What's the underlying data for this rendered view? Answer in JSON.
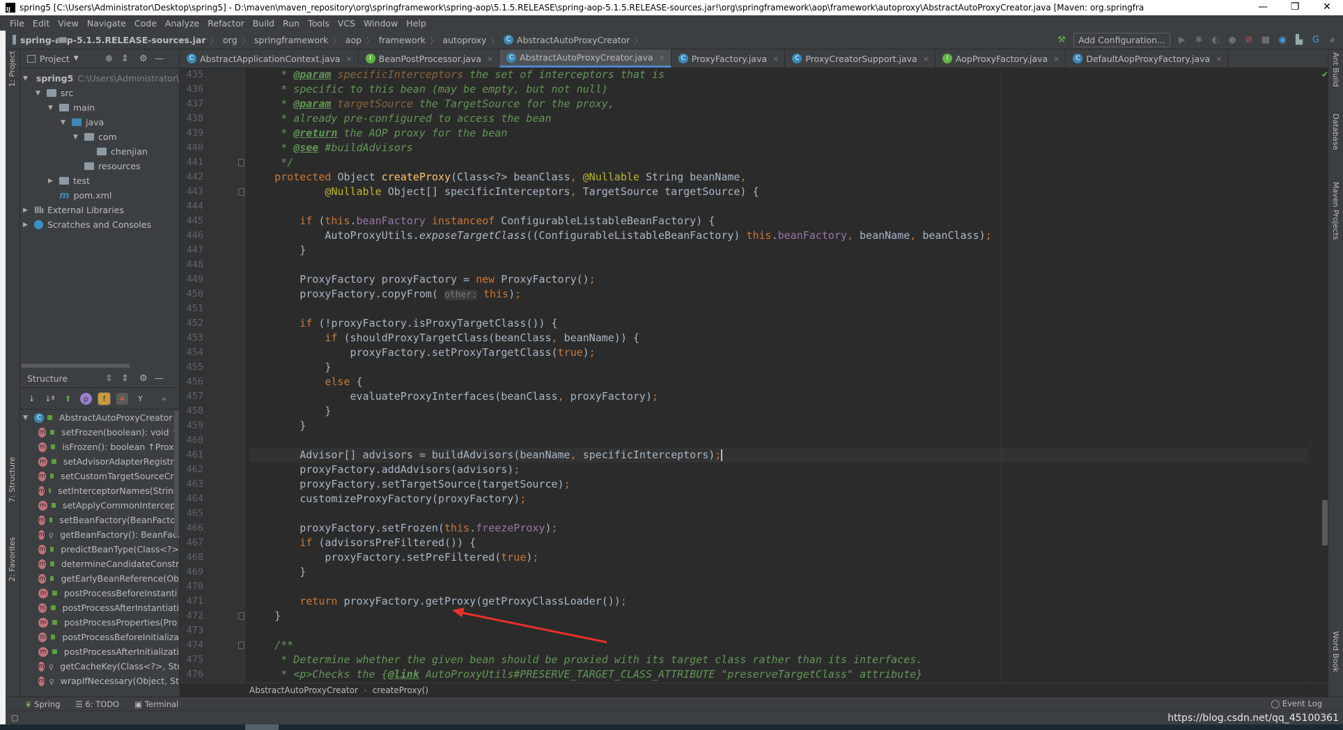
{
  "window": {
    "title": "spring5 [C:\\Users\\Administrator\\Desktop\\spring5] - D:\\maven\\maven_repository\\org\\springframework\\spring-aop\\5.1.5.RELEASE\\spring-aop-5.1.5.RELEASE-sources.jar!\\org\\springframework\\aop\\framework\\autoproxy\\AbstractAutoProxyCreator.java [Maven: org.springfra",
    "logo": "IJ",
    "minimize": "—",
    "restore": "❐",
    "close": "✕"
  },
  "menu": [
    "File",
    "Edit",
    "View",
    "Navigate",
    "Code",
    "Analyze",
    "Refactor",
    "Build",
    "Run",
    "Tools",
    "VCS",
    "Window",
    "Help"
  ],
  "navbar": {
    "crumbs": [
      "spring-aop-5.1.5.RELEASE-sources.jar",
      "org",
      "springframework",
      "aop",
      "framework",
      "autoproxy",
      "AbstractAutoProxyCreator"
    ],
    "add_configuration": "Add Configuration..."
  },
  "left_stripe": {
    "project": "1: Project",
    "structure": "7: Structure",
    "favorites": "2: Favorites"
  },
  "project": {
    "title": "Project",
    "tree": [
      {
        "label": "spring5",
        "hint": "C:\\Users\\Administrator\\",
        "depth": 0,
        "arrow": "▼",
        "icon": "module"
      },
      {
        "label": "src",
        "depth": 1,
        "arrow": "▼",
        "icon": "folder"
      },
      {
        "label": "main",
        "depth": 2,
        "arrow": "▼",
        "icon": "folder"
      },
      {
        "label": "java",
        "depth": 3,
        "arrow": "▼",
        "icon": "source-folder"
      },
      {
        "label": "com",
        "depth": 4,
        "arrow": "▼",
        "icon": "package"
      },
      {
        "label": "chenjian",
        "depth": 5,
        "arrow": "",
        "icon": "package"
      },
      {
        "label": "resources",
        "depth": 4,
        "arrow": "",
        "icon": "resources-folder"
      },
      {
        "label": "test",
        "depth": 2,
        "arrow": "▶",
        "icon": "folder"
      },
      {
        "label": "pom.xml",
        "depth": 2,
        "arrow": "",
        "icon": "maven"
      },
      {
        "label": "External Libraries",
        "depth": 0,
        "arrow": "▶",
        "icon": "libraries"
      },
      {
        "label": "Scratches and Consoles",
        "depth": 0,
        "arrow": "▶",
        "icon": "scratches"
      }
    ]
  },
  "structure": {
    "title": "Structure",
    "root": "AbstractAutoProxyCreator",
    "members": [
      {
        "label": "setFrozen(boolean): void ↑",
        "access": "public"
      },
      {
        "label": "isFrozen(): boolean ↑Proxy",
        "access": "public"
      },
      {
        "label": "setAdvisorAdapterRegistry",
        "access": "public"
      },
      {
        "label": "setCustomTargetSourceCre",
        "access": "public"
      },
      {
        "label": "setInterceptorNames(String",
        "access": "public"
      },
      {
        "label": "setApplyCommonIntercept",
        "access": "public"
      },
      {
        "label": "setBeanFactory(BeanFactor",
        "access": "public"
      },
      {
        "label": "getBeanFactory(): BeanFact",
        "access": "protected"
      },
      {
        "label": "predictBeanType(Class<?>",
        "access": "public"
      },
      {
        "label": "determineCandidateConstr",
        "access": "public"
      },
      {
        "label": "getEarlyBeanReference(Ob",
        "access": "public"
      },
      {
        "label": "postProcessBeforeInstanti",
        "access": "public"
      },
      {
        "label": "postProcessAfterInstantiati",
        "access": "public"
      },
      {
        "label": "postProcessProperties(Pro",
        "access": "public"
      },
      {
        "label": "postProcessBeforeInitializa",
        "access": "public"
      },
      {
        "label": "postProcessAfterInitializati",
        "access": "public"
      },
      {
        "label": "getCacheKey(Class<?>, Str",
        "access": "protected"
      },
      {
        "label": "wrapIfNecessary(Object, St",
        "access": "protected"
      }
    ]
  },
  "tabs": [
    {
      "label": "AbstractApplicationContext.java",
      "kind": "class",
      "active": false
    },
    {
      "label": "BeanPostProcessor.java",
      "kind": "interface",
      "active": false
    },
    {
      "label": "AbstractAutoProxyCreator.java",
      "kind": "class",
      "active": true
    },
    {
      "label": "ProxyFactory.java",
      "kind": "class",
      "active": false
    },
    {
      "label": "ProxyCreatorSupport.java",
      "kind": "class",
      "active": false
    },
    {
      "label": "AopProxyFactory.java",
      "kind": "interface",
      "active": false
    },
    {
      "label": "DefaultAopProxyFactory.java",
      "kind": "class",
      "active": false
    }
  ],
  "editor": {
    "first_line": 435,
    "current_line": 461,
    "folds": [
      441,
      443,
      472,
      474
    ],
    "lines": [
      [
        [
          "c",
          "     * "
        ],
        [
          "t",
          "@param"
        ],
        [
          "p",
          " specificInterceptors"
        ],
        [
          "c",
          " the set of interceptors that is"
        ]
      ],
      [
        [
          "c",
          "     * specific to this bean (may be empty, but not null)"
        ]
      ],
      [
        [
          "c",
          "     * "
        ],
        [
          "t",
          "@param"
        ],
        [
          "p",
          " targetSource"
        ],
        [
          "c",
          " the TargetSource for the proxy,"
        ]
      ],
      [
        [
          "c",
          "     * already pre-configured to access the bean"
        ]
      ],
      [
        [
          "c",
          "     * "
        ],
        [
          "t",
          "@return"
        ],
        [
          "c",
          " the AOP proxy for the bean"
        ]
      ],
      [
        [
          "c",
          "     * "
        ],
        [
          "t",
          "@see"
        ],
        [
          "c",
          " #buildAdvisors"
        ]
      ],
      [
        [
          "c",
          "     */"
        ]
      ],
      [
        [
          "n",
          "    "
        ],
        [
          "k",
          "protected "
        ],
        [
          "n",
          "Object "
        ],
        [
          "m",
          "createProxy"
        ],
        [
          "n",
          "(Class<?> beanClass"
        ],
        [
          "k",
          ", "
        ],
        [
          "a",
          "@Nullable "
        ],
        [
          "n",
          "String beanName"
        ],
        [
          "k",
          ","
        ]
      ],
      [
        [
          "n",
          "            "
        ],
        [
          "a",
          "@Nullable "
        ],
        [
          "n",
          "Object[] specificInterceptors"
        ],
        [
          "k",
          ", "
        ],
        [
          "n",
          "TargetSource targetSource) {"
        ]
      ],
      [],
      [
        [
          "n",
          "        "
        ],
        [
          "k",
          "if "
        ],
        [
          "n",
          "("
        ],
        [
          "k",
          "this"
        ],
        [
          "n",
          "."
        ],
        [
          "f",
          "beanFactory "
        ],
        [
          "k",
          "instanceof "
        ],
        [
          "n",
          "ConfigurableListableBeanFactory) {"
        ]
      ],
      [
        [
          "n",
          "            AutoProxyUtils."
        ],
        [
          "s",
          "exposeTargetClass"
        ],
        [
          "n",
          "((ConfigurableListableBeanFactory) "
        ],
        [
          "k",
          "this"
        ],
        [
          "n",
          "."
        ],
        [
          "f",
          "beanFactory"
        ],
        [
          "k",
          ", "
        ],
        [
          "n",
          "beanName"
        ],
        [
          "k",
          ", "
        ],
        [
          "n",
          "beanClass)"
        ],
        [
          "k",
          ";"
        ]
      ],
      [
        [
          "n",
          "        }"
        ]
      ],
      [],
      [
        [
          "n",
          "        ProxyFactory proxyFactory = "
        ],
        [
          "k",
          "new "
        ],
        [
          "n",
          "ProxyFactory()"
        ],
        [
          "k",
          ";"
        ]
      ],
      [
        [
          "n",
          "        proxyFactory.copyFrom( "
        ],
        [
          "h",
          "other:"
        ],
        [
          "n",
          " "
        ],
        [
          "k",
          "this"
        ],
        [
          "n",
          ")"
        ],
        [
          "k",
          ";"
        ]
      ],
      [],
      [
        [
          "n",
          "        "
        ],
        [
          "k",
          "if "
        ],
        [
          "n",
          "(!proxyFactory.isProxyTargetClass()) {"
        ]
      ],
      [
        [
          "n",
          "            "
        ],
        [
          "k",
          "if "
        ],
        [
          "n",
          "(shouldProxyTargetClass(beanClass"
        ],
        [
          "k",
          ", "
        ],
        [
          "n",
          "beanName)) {"
        ]
      ],
      [
        [
          "n",
          "                proxyFactory.setProxyTargetClass("
        ],
        [
          "k",
          "true"
        ],
        [
          "n",
          ")"
        ],
        [
          "k",
          ";"
        ]
      ],
      [
        [
          "n",
          "            }"
        ]
      ],
      [
        [
          "n",
          "            "
        ],
        [
          "k",
          "else "
        ],
        [
          "n",
          "{"
        ]
      ],
      [
        [
          "n",
          "                evaluateProxyInterfaces(beanClass"
        ],
        [
          "k",
          ", "
        ],
        [
          "n",
          "proxyFactory)"
        ],
        [
          "k",
          ";"
        ]
      ],
      [
        [
          "n",
          "            }"
        ]
      ],
      [
        [
          "n",
          "        }"
        ]
      ],
      [],
      [
        [
          "n",
          "        Advisor[] advisors = buildAdvisors(beanName"
        ],
        [
          "k",
          ", "
        ],
        [
          "n",
          "specificInterceptors)"
        ],
        [
          "k",
          ";"
        ]
      ],
      [
        [
          "n",
          "        proxyFactory.addAdvisors(advisors)"
        ],
        [
          "k",
          ";"
        ]
      ],
      [
        [
          "n",
          "        proxyFactory.setTargetSource(targetSource)"
        ],
        [
          "k",
          ";"
        ]
      ],
      [
        [
          "n",
          "        customizeProxyFactory(proxyFactory)"
        ],
        [
          "k",
          ";"
        ]
      ],
      [],
      [
        [
          "n",
          "        proxyFactory.setFrozen("
        ],
        [
          "k",
          "this"
        ],
        [
          "n",
          "."
        ],
        [
          "f",
          "freezeProxy"
        ],
        [
          "n",
          ")"
        ],
        [
          "k",
          ";"
        ]
      ],
      [
        [
          "n",
          "        "
        ],
        [
          "k",
          "if "
        ],
        [
          "n",
          "(advisorsPreFiltered()) {"
        ]
      ],
      [
        [
          "n",
          "            proxyFactory.setPreFiltered("
        ],
        [
          "k",
          "true"
        ],
        [
          "n",
          ")"
        ],
        [
          "k",
          ";"
        ]
      ],
      [
        [
          "n",
          "        }"
        ]
      ],
      [],
      [
        [
          "n",
          "        "
        ],
        [
          "k",
          "return "
        ],
        [
          "n",
          "proxyFactory.getProxy(getProxyClassLoader())"
        ],
        [
          "k",
          ";"
        ]
      ],
      [
        [
          "n",
          "    }"
        ]
      ],
      [],
      [
        [
          "c",
          "    /**"
        ]
      ],
      [
        [
          "c",
          "     * Determine whether the given bean should be proxied with its target class rather than its interfaces."
        ]
      ],
      [
        [
          "c",
          "     * <p>Checks the {"
        ],
        [
          "t",
          "@link"
        ],
        [
          "c",
          " AutoProxyUtils#PRESERVE_TARGET_CLASS_ATTRIBUTE \"preserveTargetClass\" attribute}"
        ]
      ]
    ]
  },
  "breadcrumb": {
    "class": "AbstractAutoProxyCreator",
    "method": "createProxy()"
  },
  "right_stripe": {
    "ant": "Ant Build",
    "database": "Database",
    "maven": "Maven Projects",
    "wordbook": "Word Book"
  },
  "bottom_tools": {
    "spring": "Spring",
    "todo": "6: TODO",
    "terminal": "Terminal",
    "event_log": "Event Log"
  },
  "watermark": "https://blog.csdn.net/qq_45100361",
  "colors": {
    "keyword": "#cc7832",
    "comment": "#629755",
    "method": "#ffc66d",
    "field": "#9876aa",
    "annotation": "#bbb529",
    "text": "#a9b7c6",
    "editor_bg": "#2b2b2b",
    "annotation_arrow": "#e8302a"
  }
}
